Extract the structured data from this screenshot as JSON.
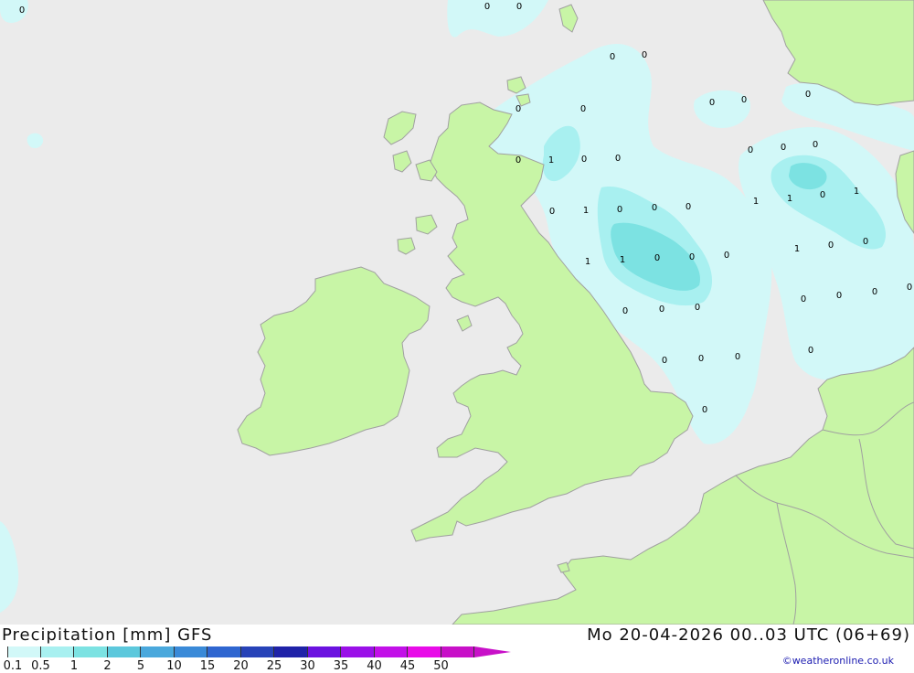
{
  "title": "Precipitation [mm] GFS",
  "valid_time": "Mo 20-04-2026 00..03 UTC (06+69)",
  "credit": "©weatheronline.co.uk",
  "colors": {
    "sea": "#ebebeb",
    "land": "#c8f5a6",
    "coast": "#a0a0a0",
    "precip_light": "#d2f8f8",
    "precip_mid": "#a8f0f0",
    "precip_strong": "#7ce2e2"
  },
  "legend": {
    "labels": [
      "0.1",
      "0.5",
      "1",
      "2",
      "5",
      "10",
      "15",
      "20",
      "25",
      "30",
      "35",
      "40",
      "45",
      "50"
    ],
    "colors": [
      "#d2f8f8",
      "#a8f0f0",
      "#7ce2e2",
      "#5cc8dc",
      "#4aa8dc",
      "#3a8ad8",
      "#2f66d0",
      "#2743b8",
      "#1f22a8",
      "#6b12e0",
      "#9a10e8",
      "#c210e8",
      "#e80ce8",
      "#c810c8"
    ]
  },
  "value_labels": [
    {
      "text": "0"
    },
    {
      "text": "0"
    },
    {
      "text": "0"
    },
    {
      "text": "0"
    },
    {
      "text": "0"
    },
    {
      "text": "0"
    },
    {
      "text": "0"
    },
    {
      "text": "0"
    },
    {
      "text": "0"
    },
    {
      "text": "0"
    },
    {
      "text": "0"
    },
    {
      "text": "1"
    },
    {
      "text": "0"
    },
    {
      "text": "0"
    },
    {
      "text": "0"
    },
    {
      "text": "0"
    },
    {
      "text": "0"
    },
    {
      "text": "0"
    },
    {
      "text": "1"
    },
    {
      "text": "0"
    },
    {
      "text": "0"
    },
    {
      "text": "0"
    },
    {
      "text": "1"
    },
    {
      "text": "1"
    },
    {
      "text": "0"
    },
    {
      "text": "1"
    },
    {
      "text": "1"
    },
    {
      "text": "1"
    },
    {
      "text": "0"
    },
    {
      "text": "0"
    },
    {
      "text": "0"
    },
    {
      "text": "1"
    },
    {
      "text": "0"
    },
    {
      "text": "0"
    },
    {
      "text": "0"
    },
    {
      "text": "0"
    },
    {
      "text": "0"
    },
    {
      "text": "0"
    },
    {
      "text": "0"
    },
    {
      "text": "0"
    },
    {
      "text": "0"
    },
    {
      "text": "0"
    },
    {
      "text": "0"
    },
    {
      "text": "0"
    },
    {
      "text": "0"
    },
    {
      "text": "0"
    }
  ]
}
